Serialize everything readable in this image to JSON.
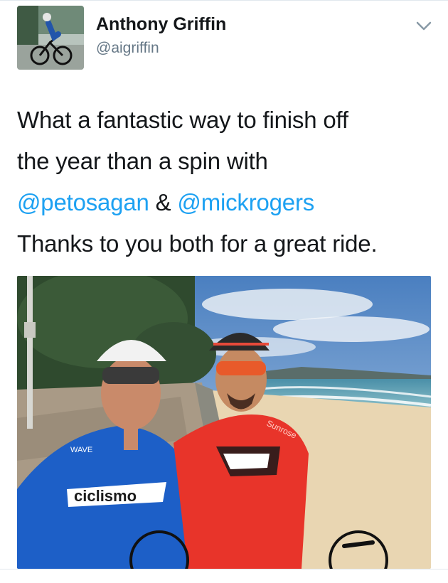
{
  "author": {
    "name": "Anthony Griffin",
    "handle": "@aigriffin",
    "avatar_icon": "cyclist-avatar"
  },
  "menu_icon": "chevron-down-icon",
  "tweet": {
    "line1": "What a fantastic way to finish off",
    "line2": "the year than a spin with",
    "mention1": "@petosagan",
    "amp": " & ",
    "mention2": "@mickrogers",
    "line4": "Thanks to you both for a great ride."
  },
  "photo": {
    "left_jersey_text": "ciclismo",
    "left_jersey_brand": "WAVE",
    "right_jersey_text": "Sunrose"
  },
  "colors": {
    "mention": "#1da1f2",
    "text": "#14171a",
    "handle": "#657786"
  }
}
